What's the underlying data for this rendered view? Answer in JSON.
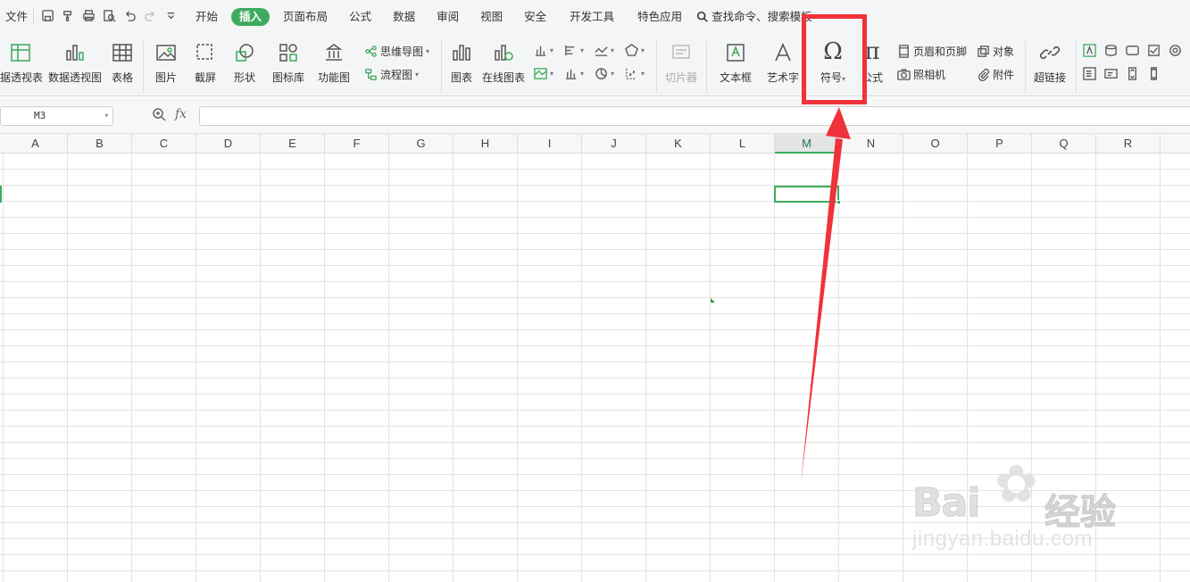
{
  "menu": {
    "file": "文件",
    "tabs": [
      "开始",
      "插入",
      "页面布局",
      "公式",
      "数据",
      "审阅",
      "视图",
      "安全",
      "开发工具",
      "特色应用"
    ],
    "active_tab": "插入",
    "search": "查找命令、搜索模板"
  },
  "ribbon": {
    "pivot_table": "据透视表",
    "pivot_chart": "数据透视图",
    "table": "表格",
    "picture": "图片",
    "screenshot": "截屏",
    "shapes": "形状",
    "icons": "图标库",
    "function_chart": "功能图",
    "mindmap": "思维导图",
    "flowchart": "流程图",
    "chart": "图表",
    "online_chart": "在线图表",
    "slicer": "切片器",
    "textbox": "文本框",
    "wordart": "艺术字",
    "symbol": "符号",
    "formula": "公式",
    "header_footer": "页眉和页脚",
    "camera": "照相机",
    "object": "对象",
    "attachment": "附件",
    "hyperlink": "超链接"
  },
  "formula_bar": {
    "cell_ref": "M3",
    "fx": "fx",
    "value": ""
  },
  "columns": [
    "A",
    "B",
    "C",
    "D",
    "E",
    "F",
    "G",
    "H",
    "I",
    "J",
    "K",
    "L",
    "M",
    "N",
    "O",
    "P",
    "Q",
    "R"
  ],
  "selected_column": "M",
  "annotation_color": "#f0323a",
  "accent_color": "#3daa5d",
  "watermark": {
    "brand": "Bai",
    "brand2": "经验",
    "url": "jingyan.baidu.com"
  }
}
